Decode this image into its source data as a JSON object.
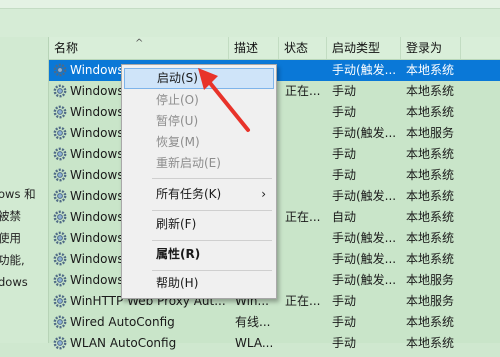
{
  "columns": {
    "name": "名称",
    "desc": "描述",
    "status": "状态",
    "startup": "启动类型",
    "logon": "登录为"
  },
  "left_description": [
    "ows 和",
    "被禁",
    "使用",
    "功能,",
    "dows"
  ],
  "rows": [
    {
      "name": "Windows",
      "desc": "",
      "status": "",
      "startup": "手动(触发...",
      "logon": "本地系统",
      "selected": true
    },
    {
      "name": "Windows",
      "desc": "",
      "status": "正在...",
      "startup": "手动",
      "logon": "本地系统"
    },
    {
      "name": "Windows",
      "desc": "",
      "status": "",
      "startup": "手动",
      "logon": "本地系统"
    },
    {
      "name": "Windows",
      "desc": "",
      "status": "",
      "startup": "手动(触发...",
      "logon": "本地服务"
    },
    {
      "name": "Windows",
      "desc": "",
      "status": "",
      "startup": "手动",
      "logon": "本地系统"
    },
    {
      "name": "Windows",
      "desc": "",
      "status": "",
      "startup": "手动",
      "logon": "本地系统"
    },
    {
      "name": "Windows",
      "desc": "",
      "status": "",
      "startup": "手动(触发...",
      "logon": "本地系统"
    },
    {
      "name": "Windows",
      "desc": "",
      "status": "正在...",
      "startup": "自动",
      "logon": "本地系统"
    },
    {
      "name": "Windows",
      "desc": "",
      "status": "",
      "startup": "手动(触发...",
      "logon": "本地系统"
    },
    {
      "name": "Windows",
      "desc": "",
      "status": "",
      "startup": "手动(触发...",
      "logon": "本地系统"
    },
    {
      "name": "Windows",
      "desc": "",
      "status": "",
      "startup": "手动(触发...",
      "logon": "本地服务"
    },
    {
      "name": "WinHTTP Web Proxy Aut...",
      "desc": "Win...",
      "status": "正在...",
      "startup": "手动",
      "logon": "本地服务"
    },
    {
      "name": "Wired AutoConfig",
      "desc": "有线...",
      "status": "",
      "startup": "手动",
      "logon": "本地系统"
    },
    {
      "name": "WLAN AutoConfig",
      "desc": "WLA...",
      "status": "",
      "startup": "手动",
      "logon": "本地系统"
    }
  ],
  "context_menu": {
    "start": "启动(S)",
    "stop": "停止(O)",
    "pause": "暂停(U)",
    "resume": "恢复(M)",
    "restart": "重新启动(E)",
    "all_tasks": "所有任务(K)",
    "refresh": "刷新(F)",
    "properties": "属性(R)",
    "help": "帮助(H)"
  },
  "colors": {
    "selection": "#0a78d7",
    "menu_highlight": "#cfe4f9",
    "arrow": "#e8332a"
  },
  "icons": {
    "service": "gear-icon",
    "submenu": "chevron-right-icon"
  }
}
